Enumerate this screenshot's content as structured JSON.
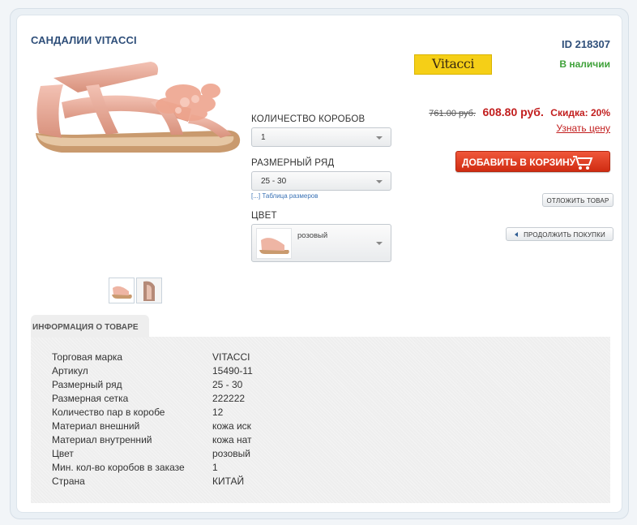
{
  "product": {
    "title": "САНДАЛИИ VITACCI",
    "id_label": "ID 218307",
    "brand_logo_text": "Vitacci",
    "stock_status": "В наличии"
  },
  "options": {
    "boxes_label": "КОЛИЧЕСТВО КОРОБОВ",
    "boxes_value": "1",
    "size_label": "РАЗМЕРНЫЙ РЯД",
    "size_value": "25 - 30",
    "size_table_link": "[...] Таблица размеров",
    "color_label": "ЦВЕТ",
    "color_value": "розовый"
  },
  "pricing": {
    "old_price": "761.00 руб.",
    "new_price": "608.80 руб.",
    "discount": "Скидка: 20%",
    "price_link": "Узнать цену"
  },
  "buttons": {
    "add_to_cart": "ДОБАВИТЬ В КОРЗИНУ",
    "defer": "ОТЛОЖИТЬ ТОВАР",
    "continue_shopping": "ПРОДОЛЖИТЬ ПОКУПКИ"
  },
  "info": {
    "tab_label": "ИНФОРМАЦИЯ О ТОВАРЕ",
    "specs": [
      {
        "label": "Торговая марка",
        "value": "VITACCI"
      },
      {
        "label": "Артикул",
        "value": "15490-11"
      },
      {
        "label": "Размерный ряд",
        "value": "25 - 30"
      },
      {
        "label": "Размерная сетка",
        "value": "222222"
      },
      {
        "label": "Количество пар в коробе",
        "value": "12"
      },
      {
        "label": "Материал внешний",
        "value": "кожа иск"
      },
      {
        "label": "Материал внутренний",
        "value": "кожа нат"
      },
      {
        "label": "Цвет",
        "value": "розовый"
      },
      {
        "label": "Мин. кол-во коробов в заказе",
        "value": "1"
      },
      {
        "label": "Страна",
        "value": "КИТАЙ"
      }
    ]
  },
  "colors": {
    "title": "#2f4f7a",
    "price_red": "#c21e1e",
    "stock_green": "#3fa23a",
    "cart_button": "#e0401f"
  }
}
